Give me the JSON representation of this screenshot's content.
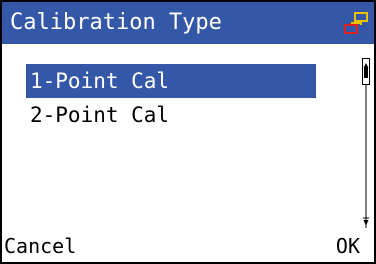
{
  "title": "Calibration Type",
  "status_icon": "network-icon",
  "options": [
    {
      "label": "1-Point Cal",
      "selected": true
    },
    {
      "label": "2-Point Cal",
      "selected": false
    }
  ],
  "softkeys": {
    "left": "Cancel",
    "right": "OK"
  },
  "colors": {
    "accent": "#3557a8",
    "icon_yellow": "#e8c400",
    "icon_red": "#e02020",
    "background": "#ffffff"
  }
}
